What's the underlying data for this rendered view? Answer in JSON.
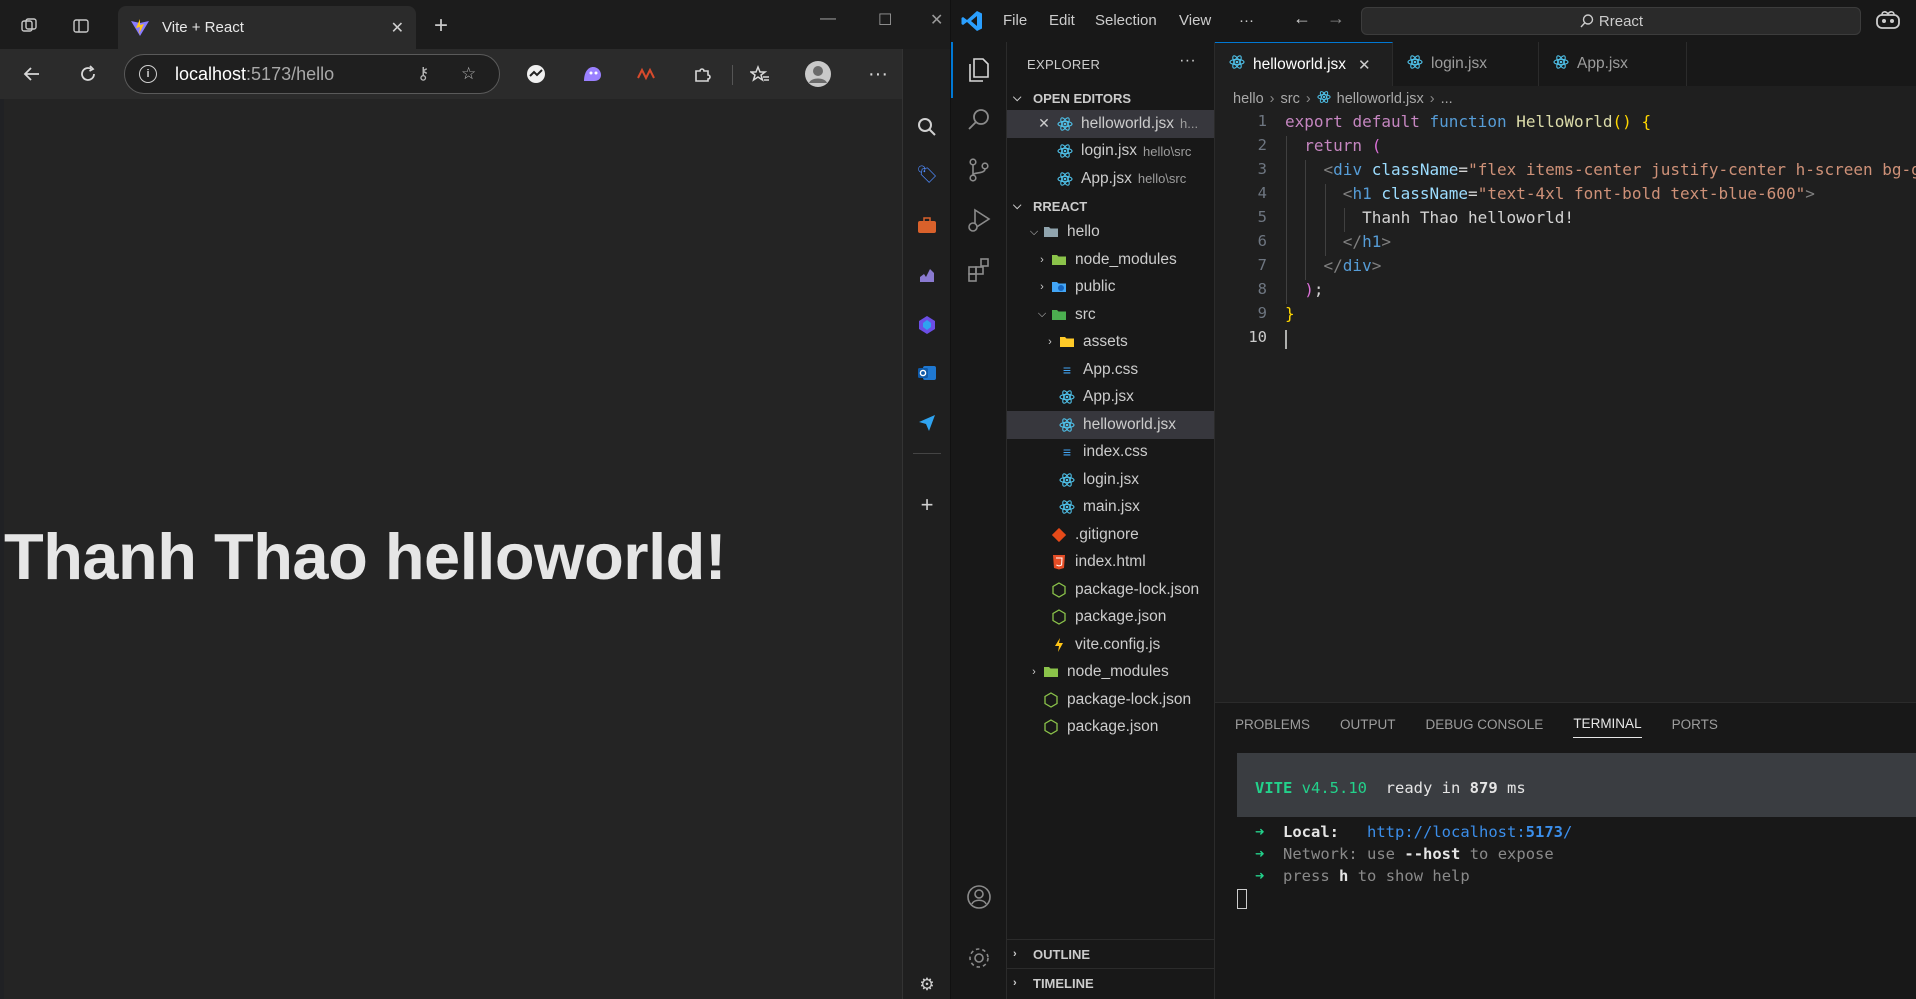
{
  "browser": {
    "tab_title": "Vite + React",
    "url_host": "localhost",
    "url_rest": ":5173/hello",
    "page_heading": "Thanh Thao helloworld!"
  },
  "vscode": {
    "menu": [
      "File",
      "Edit",
      "Selection",
      "View",
      "···"
    ],
    "command_center": "Rreact",
    "explorer_title": "EXPLORER",
    "open_editors_title": "OPEN EDITORS",
    "open_editors": [
      {
        "name": "helloworld.jsx",
        "desc": "h..."
      },
      {
        "name": "login.jsx",
        "desc": "hello\\src"
      },
      {
        "name": "App.jsx",
        "desc": "hello\\src"
      }
    ],
    "workspace_title": "RREACT",
    "tree": {
      "hello": "hello",
      "node_modules": "node_modules",
      "public": "public",
      "src": "src",
      "assets": "assets",
      "app_css": "App.css",
      "app_jsx": "App.jsx",
      "helloworld_jsx": "helloworld.jsx",
      "index_css": "index.css",
      "login_jsx": "login.jsx",
      "main_jsx": "main.jsx",
      "gitignore": ".gitignore",
      "index_html": "index.html",
      "package_lock": "package-lock.json",
      "package_json": "package.json",
      "vite_config": "vite.config.js",
      "root_node_modules": "node_modules",
      "root_package_lock": "package-lock.json",
      "root_package_json": "package.json"
    },
    "outline_title": "OUTLINE",
    "timeline_title": "TIMELINE",
    "tabs": [
      "helloworld.jsx",
      "login.jsx",
      "App.jsx"
    ],
    "breadcrumb": [
      "hello",
      "src",
      "helloworld.jsx",
      "..."
    ],
    "line_numbers": [
      "1",
      "2",
      "3",
      "4",
      "5",
      "6",
      "7",
      "8",
      "9",
      "10"
    ],
    "panel_tabs": [
      "PROBLEMS",
      "OUTPUT",
      "DEBUG CONSOLE",
      "TERMINAL",
      "PORTS"
    ],
    "terminal": {
      "vite": "VITE",
      "version": "v4.5.10",
      "ready": "ready in",
      "ms_value": "879",
      "ms": "ms",
      "local_label": "Local:",
      "local_url_a": "http://localhost:",
      "local_url_port": "5173",
      "local_url_b": "/",
      "network_label": "Network:",
      "network_a": "use",
      "network_flag": "--host",
      "network_b": "to expose",
      "press": "press",
      "press_key": "h",
      "press_b": "to show help"
    }
  }
}
